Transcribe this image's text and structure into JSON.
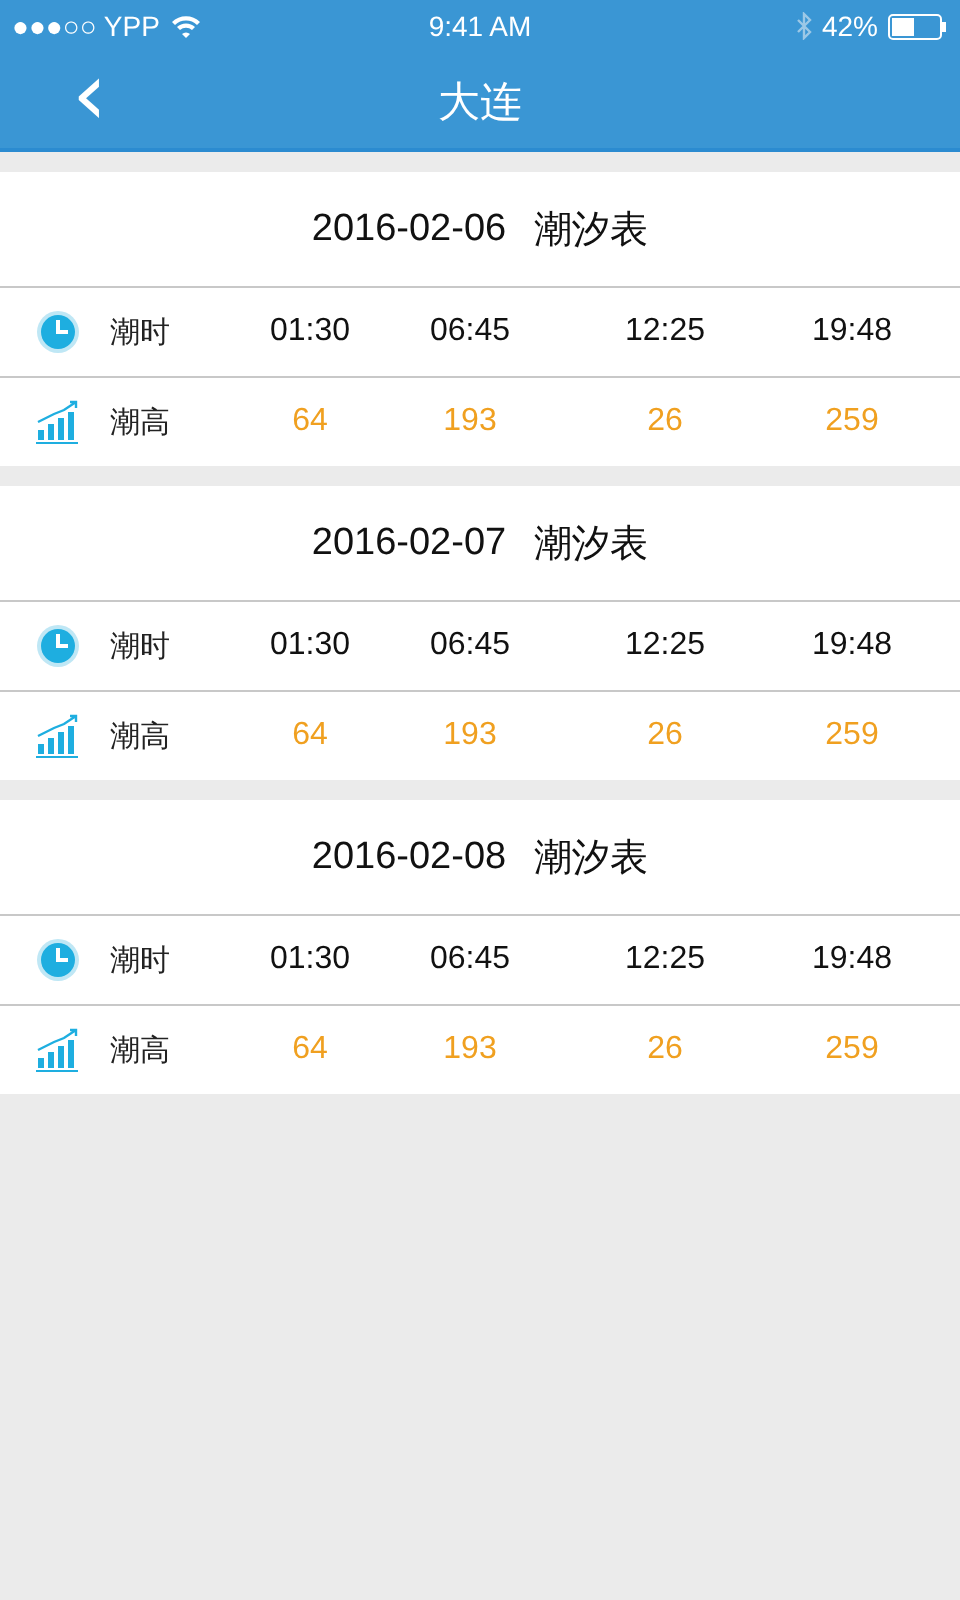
{
  "status_bar": {
    "carrier": "●●●○○ YPP",
    "time": "9:41 AM",
    "battery": "42%"
  },
  "nav": {
    "back": "‹",
    "title": "大连"
  },
  "tables": [
    {
      "date": "2016-02-06",
      "title": "潮汐表",
      "rows": [
        {
          "kind": "time",
          "label": "潮时",
          "values": [
            "01:30",
            "06:45",
            "12:25",
            "19:48"
          ]
        },
        {
          "kind": "height",
          "label": "潮高",
          "values": [
            "64",
            "193",
            "26",
            "259"
          ]
        }
      ]
    },
    {
      "date": "2016-02-07",
      "title": "潮汐表",
      "rows": [
        {
          "kind": "time",
          "label": "潮时",
          "values": [
            "01:30",
            "06:45",
            "12:25",
            "19:48"
          ]
        },
        {
          "kind": "height",
          "label": "潮高",
          "values": [
            "64",
            "193",
            "26",
            "259"
          ]
        }
      ]
    },
    {
      "date": "2016-02-08",
      "title": "潮汐表",
      "rows": [
        {
          "kind": "time",
          "label": "潮时",
          "values": [
            "01:30",
            "06:45",
            "12:25",
            "19:48"
          ]
        },
        {
          "kind": "height",
          "label": "潮高",
          "values": [
            "64",
            "193",
            "26",
            "259"
          ]
        }
      ]
    }
  ]
}
